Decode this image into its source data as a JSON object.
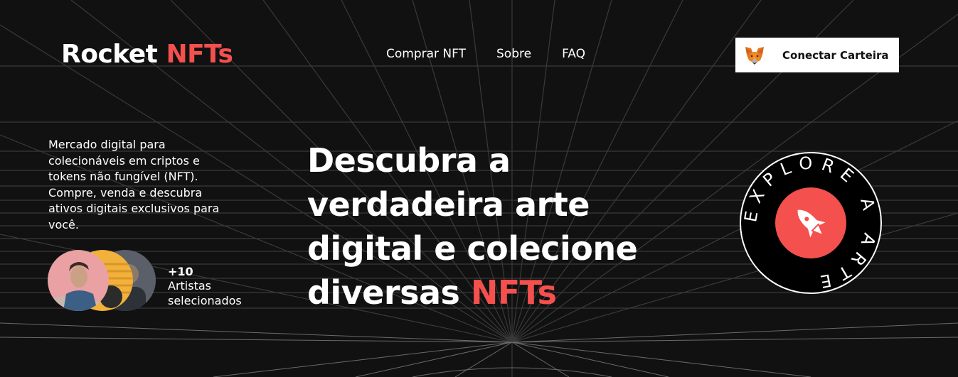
{
  "brand": {
    "name_main": "Rocket",
    "name_accent": "NFTs",
    "accent_color": "#f4504e"
  },
  "nav": {
    "items": [
      {
        "label": "Comprar NFT"
      },
      {
        "label": "Sobre"
      },
      {
        "label": "FAQ"
      }
    ]
  },
  "wallet": {
    "label": "Conectar Carteira",
    "icon": "metamask-fox-icon"
  },
  "intro": {
    "text": "Mercado digital para colecionáveis em criptos e tokens não fungível (NFT). Compre, venda e descubra ativos digitais exclusivos para você."
  },
  "artists": {
    "count": "+10",
    "label": "Artistas selecionados"
  },
  "hero": {
    "line": "Descubra a verdadeira arte digital e colecione diversas",
    "accent": "NFTs"
  },
  "badge": {
    "ring_text": "EXPLORE A ARTE",
    "icon": "rocket-icon"
  }
}
